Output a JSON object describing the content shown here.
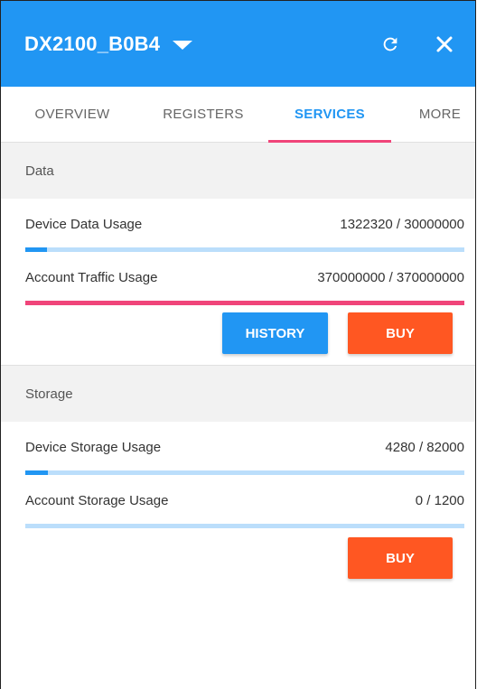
{
  "header": {
    "device_name": "DX2100_B0B4",
    "bg_color": "#2196f3",
    "icons": [
      "chevron-down-icon",
      "refresh-icon",
      "close-icon"
    ]
  },
  "tabs": [
    {
      "label": "OVERVIEW",
      "active": false
    },
    {
      "label": "REGISTERS",
      "active": false
    },
    {
      "label": "SERVICES",
      "active": true
    },
    {
      "label": "MORE",
      "active": false
    }
  ],
  "sections": {
    "data": {
      "title": "Data",
      "rows": [
        {
          "label": "Device Data Usage",
          "value_text": "1322320 / 30000000",
          "used": 1322320,
          "total": 30000000
        },
        {
          "label": "Account Traffic Usage",
          "value_text": "370000000 / 370000000",
          "used": 370000000,
          "total": 370000000
        }
      ],
      "history_label": "HISTORY",
      "buy_label": "BUY"
    },
    "storage": {
      "title": "Storage",
      "rows": [
        {
          "label": "Device Storage Usage",
          "value_text": "4280 / 82000",
          "used": 4280,
          "total": 82000
        },
        {
          "label": "Account Storage Usage",
          "value_text": "0 / 1200",
          "used": 0,
          "total": 1200
        }
      ],
      "buy_label": "BUY"
    }
  },
  "colors": {
    "accent": "#2196f3",
    "tab_indicator": "#f0457a",
    "bar_track": "#bbdefb",
    "bar_full": "#f0457a",
    "buy_button": "#ff5722"
  }
}
